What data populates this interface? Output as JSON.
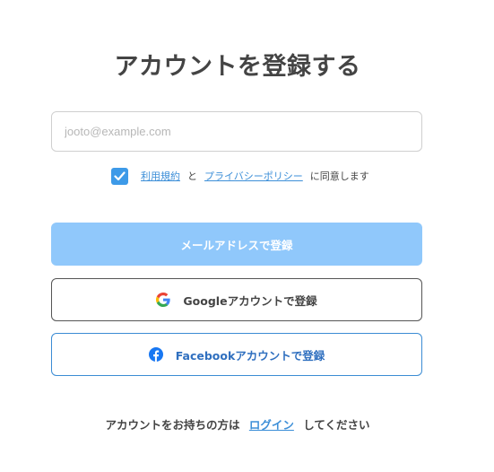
{
  "page": {
    "title": "アカウントを登録する"
  },
  "form": {
    "email_placeholder": "jooto@example.com",
    "email_value": "",
    "terms_checked": true,
    "terms_link": "利用規約",
    "and_text": "と",
    "privacy_link": "プライバシーポリシー",
    "agree_text": "に同意します"
  },
  "buttons": {
    "email_signup": "メールアドレスで登録",
    "google_signup": "Googleアカウントで登録",
    "facebook_signup": "Facebookアカウントで登録"
  },
  "footer": {
    "prefix": "アカウントをお持ちの方は",
    "login_link": "ログイン",
    "suffix": "してください"
  },
  "colors": {
    "accent": "#3d9ae8",
    "primary_button_disabled": "#90c8fb",
    "facebook_blue": "#1877f2"
  },
  "icons": {
    "checkbox": "check-icon",
    "google": "google-icon",
    "facebook": "facebook-icon"
  }
}
